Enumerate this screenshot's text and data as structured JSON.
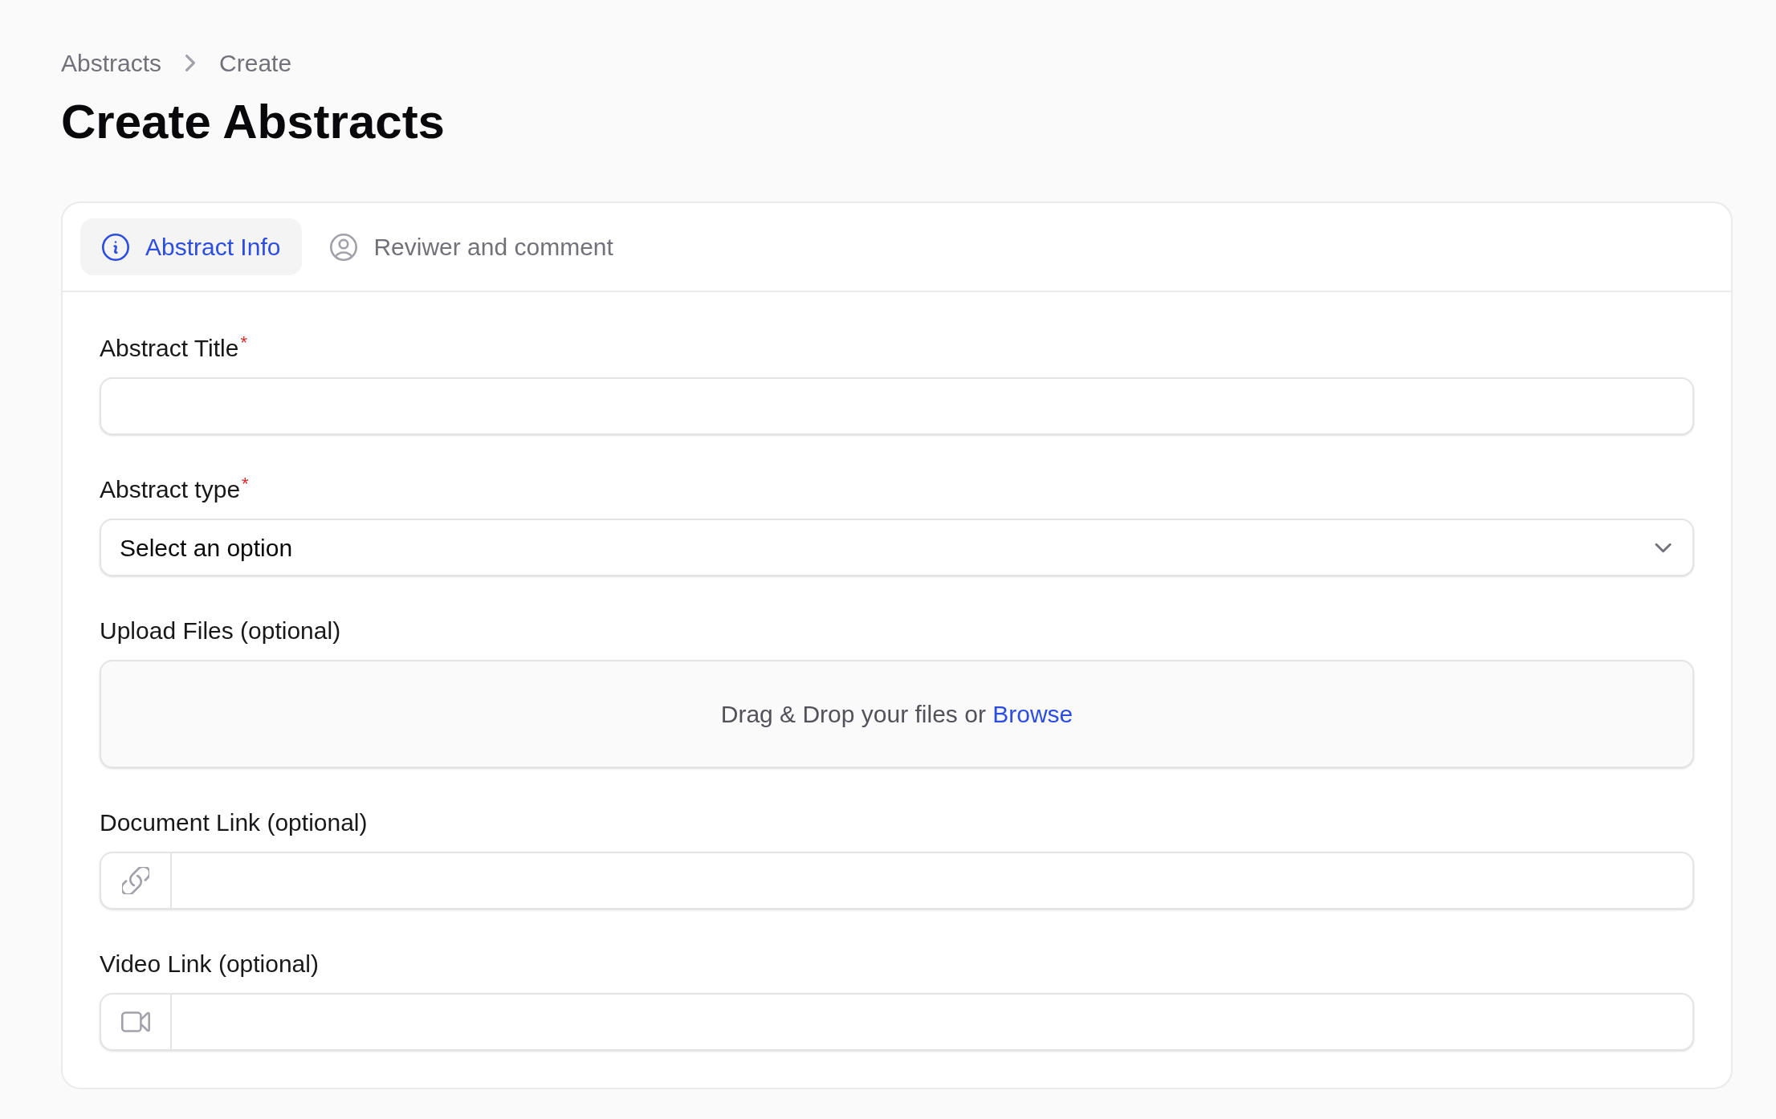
{
  "breadcrumbs": [
    {
      "label": "Abstracts"
    },
    {
      "label": "Create"
    }
  ],
  "page_title": "Create Abstracts",
  "tabs": [
    {
      "label": "Abstract Info",
      "selected": true
    },
    {
      "label": "Reviwer and comment",
      "selected": false
    }
  ],
  "fields": [
    {
      "kind": "text",
      "label": "Abstract Title",
      "required_mark": "*"
    },
    {
      "kind": "select",
      "label": "Abstract type",
      "required_mark": "*",
      "value": "Select an option"
    },
    {
      "kind": "upload",
      "label": "Upload Files (optional)",
      "prompt": "Drag & Drop your files or",
      "link": "Browse"
    },
    {
      "kind": "document",
      "label": "Document Link (optional)"
    },
    {
      "kind": "video",
      "label": "Video Link (optional)"
    }
  ]
}
